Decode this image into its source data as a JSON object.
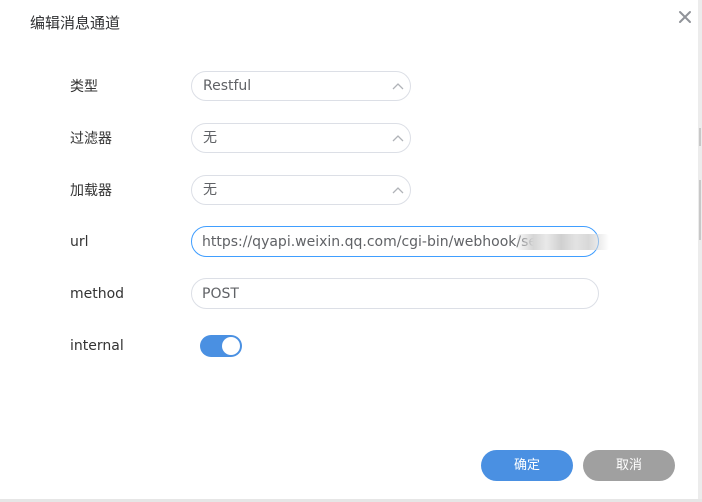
{
  "dialog": {
    "title": "编辑消息通道"
  },
  "form": {
    "type": {
      "label": "类型",
      "value": "Restful"
    },
    "filter": {
      "label": "过滤器",
      "value": "无"
    },
    "loader": {
      "label": "加载器",
      "value": "无"
    },
    "url": {
      "label": "url",
      "value": "https://qyapi.weixin.qq.com/cgi-bin/webhook/send?"
    },
    "method": {
      "label": "method",
      "value": "POST"
    },
    "internal": {
      "label": "internal",
      "checked": true
    }
  },
  "buttons": {
    "confirm": "确定",
    "cancel": "取消"
  },
  "colors": {
    "accent": "#4a90e2",
    "cancel": "#a0a0a0"
  },
  "icons": {
    "close": "close-icon",
    "select_arrow": "chevron-up-icon"
  }
}
